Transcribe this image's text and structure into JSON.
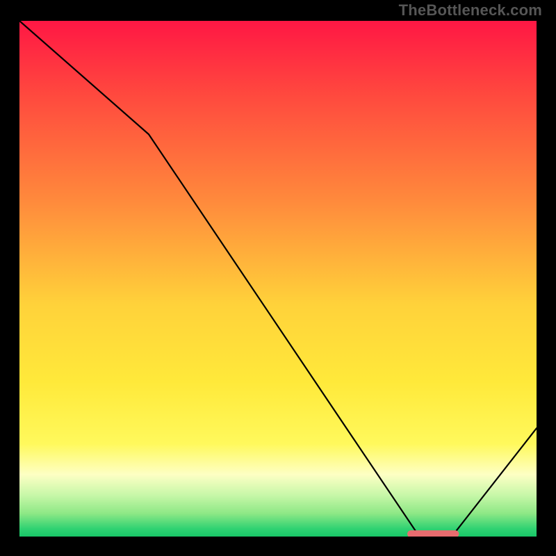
{
  "attribution": "TheBottleneck.com",
  "chart_data": {
    "type": "line",
    "title": "",
    "xlabel": "",
    "ylabel": "",
    "xlim": [
      0,
      100
    ],
    "ylim": [
      0,
      100
    ],
    "series": [
      {
        "name": "curve",
        "x": [
          0,
          25,
          77,
          84,
          100
        ],
        "values": [
          100,
          78,
          0.5,
          0.5,
          21
        ]
      }
    ],
    "marker": {
      "x_range": [
        75,
        85
      ],
      "y": 0.5,
      "color": "#e86c6f"
    },
    "background_gradient": {
      "stops": [
        {
          "offset": 0,
          "color": "#ff1744"
        },
        {
          "offset": 0.15,
          "color": "#ff4b3e"
        },
        {
          "offset": 0.35,
          "color": "#ff8a3c"
        },
        {
          "offset": 0.55,
          "color": "#ffd23a"
        },
        {
          "offset": 0.7,
          "color": "#ffe93a"
        },
        {
          "offset": 0.82,
          "color": "#fff95c"
        },
        {
          "offset": 0.88,
          "color": "#fdffc4"
        },
        {
          "offset": 0.92,
          "color": "#c7f7a8"
        },
        {
          "offset": 0.955,
          "color": "#8ee886"
        },
        {
          "offset": 0.985,
          "color": "#2fd272"
        },
        {
          "offset": 1.0,
          "color": "#18c768"
        }
      ]
    }
  }
}
